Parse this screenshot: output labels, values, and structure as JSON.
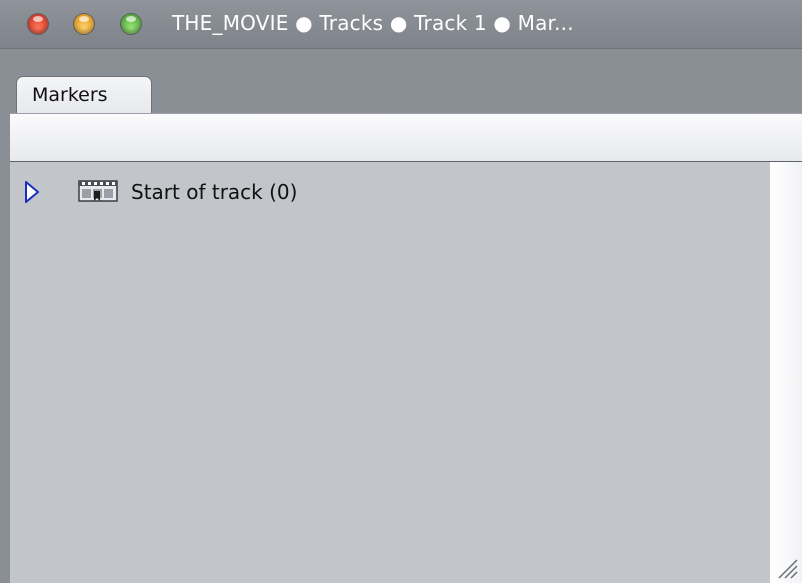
{
  "window": {
    "title": "THE_MOVIE ● Tracks ● Track 1 ● Mar..."
  },
  "tabs": [
    {
      "label": "Markers"
    }
  ],
  "markers": [
    {
      "label": "Start of track (0)",
      "expanded": false
    }
  ],
  "icons": {
    "close": "close-icon",
    "minimize": "minimize-icon",
    "zoom": "zoom-icon",
    "disclosure": "disclosure-triangle-icon",
    "marker": "film-marker-icon",
    "resize": "resize-grip-icon"
  },
  "colors": {
    "close": "#e0412c",
    "minimize": "#efaa2e",
    "zoom": "#5bbb3c",
    "disclosure": "#1a2dbd"
  }
}
